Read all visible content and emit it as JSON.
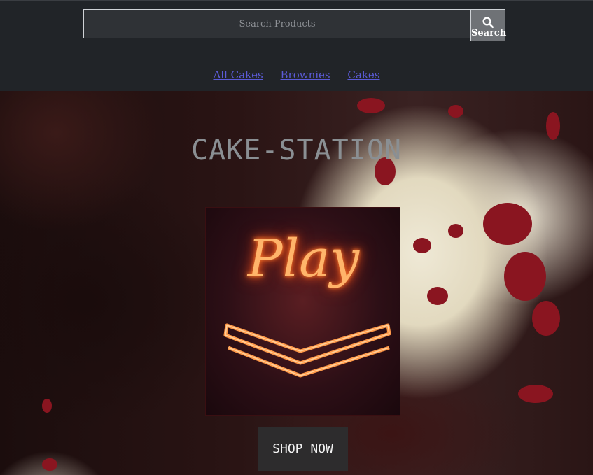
{
  "search": {
    "placeholder": "Search Products",
    "button_label": "Search",
    "button_icon": "search-icon"
  },
  "nav": {
    "items": [
      {
        "label": "All Cakes"
      },
      {
        "label": "Brownies"
      },
      {
        "label": "Cakes"
      }
    ]
  },
  "hero": {
    "brand": "CAKE-STATION",
    "promo_image_label": "Play",
    "cta_label": "SHOP NOW"
  },
  "colors": {
    "header_bg": "#212428",
    "link": "#5b5bd6",
    "button_bg": "#2d2c2d",
    "neon": "#ff7a2a"
  }
}
